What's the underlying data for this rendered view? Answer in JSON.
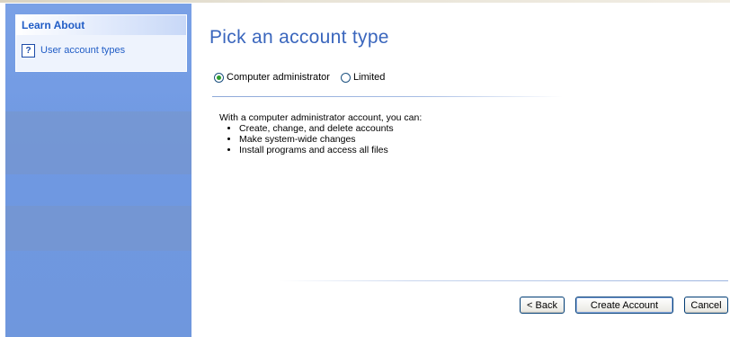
{
  "sidebar": {
    "learn_header": "Learn About",
    "learn_items": [
      {
        "label": "User account types",
        "icon": "help-icon"
      }
    ]
  },
  "main": {
    "title": "Pick an account type",
    "account_types": [
      {
        "label": "Computer administrator",
        "selected": true
      },
      {
        "label": "Limited",
        "selected": false
      }
    ],
    "description_intro": "With a computer administrator account, you can:",
    "capabilities": [
      "Create, change, and delete accounts",
      "Make system-wide changes",
      "Install programs and access all files"
    ]
  },
  "buttons": {
    "back": "< Back",
    "create": "Create Account",
    "cancel": "Cancel"
  },
  "colors": {
    "sidebar_blue": "#6f98e2",
    "title_blue": "#3a66bd",
    "link_blue": "#215dc6",
    "radio_dot_green": "#2d9c2d"
  }
}
